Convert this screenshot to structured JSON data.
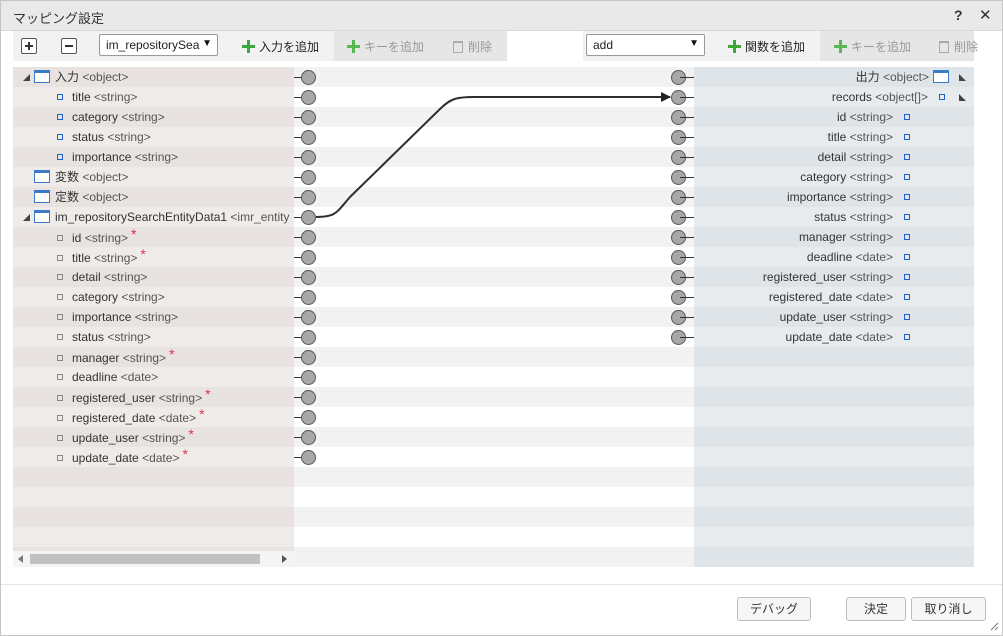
{
  "dialog": {
    "title": "マッピング設定",
    "help_label": "?",
    "close_label": "✕"
  },
  "toolbar_left": {
    "expand_icon": "plus-square-icon",
    "collapse_icon": "minus-square-icon",
    "source_select_value": "im_repositorySea",
    "add_input_label": "入力を追加",
    "add_key_label": "キーを追加",
    "delete_label": "削除"
  },
  "toolbar_right": {
    "function_select_value": "add",
    "add_function_label": "関数を追加",
    "add_key_label": "キーを追加",
    "delete_label": "削除"
  },
  "left_tree": [
    {
      "label": "入力",
      "type": "<object>",
      "kind": "object",
      "expandable": true,
      "indent": 0,
      "required": false
    },
    {
      "label": "title",
      "type": "<string>",
      "kind": "leaf",
      "indent": 1,
      "required": false
    },
    {
      "label": "category",
      "type": "<string>",
      "kind": "leaf",
      "indent": 1,
      "required": false
    },
    {
      "label": "status",
      "type": "<string>",
      "kind": "leaf",
      "indent": 1,
      "required": false
    },
    {
      "label": "importance",
      "type": "<string>",
      "kind": "leaf",
      "indent": 1,
      "required": false
    },
    {
      "label": "変数",
      "type": "<object>",
      "kind": "object",
      "expandable": false,
      "indent": 0,
      "required": false
    },
    {
      "label": "定数",
      "type": "<object>",
      "kind": "object",
      "expandable": false,
      "indent": 0,
      "required": false
    },
    {
      "label": "im_repositorySearchEntityData1",
      "type": "<imr_entity",
      "kind": "object",
      "expandable": true,
      "indent": 0,
      "required": false
    },
    {
      "label": "id",
      "type": "<string>",
      "kind": "leaf-gray",
      "indent": 1,
      "required": true
    },
    {
      "label": "title",
      "type": "<string>",
      "kind": "leaf-gray",
      "indent": 1,
      "required": true
    },
    {
      "label": "detail",
      "type": "<string>",
      "kind": "leaf-gray",
      "indent": 1,
      "required": false
    },
    {
      "label": "category",
      "type": "<string>",
      "kind": "leaf-gray",
      "indent": 1,
      "required": false
    },
    {
      "label": "importance",
      "type": "<string>",
      "kind": "leaf-gray",
      "indent": 1,
      "required": false
    },
    {
      "label": "status",
      "type": "<string>",
      "kind": "leaf-gray",
      "indent": 1,
      "required": false
    },
    {
      "label": "manager",
      "type": "<string>",
      "kind": "leaf-gray",
      "indent": 1,
      "required": true
    },
    {
      "label": "deadline",
      "type": "<date>",
      "kind": "leaf-gray",
      "indent": 1,
      "required": false
    },
    {
      "label": "registered_user",
      "type": "<string>",
      "kind": "leaf-gray",
      "indent": 1,
      "required": true
    },
    {
      "label": "registered_date",
      "type": "<date>",
      "kind": "leaf-gray",
      "indent": 1,
      "required": true
    },
    {
      "label": "update_user",
      "type": "<string>",
      "kind": "leaf-gray",
      "indent": 1,
      "required": true
    },
    {
      "label": "update_date",
      "type": "<date>",
      "kind": "leaf-gray",
      "indent": 1,
      "required": true
    }
  ],
  "right_tree": [
    {
      "label": "出力",
      "type": "<object>",
      "kind": "object",
      "expandable": true
    },
    {
      "label": "records",
      "type": "<object[]>",
      "kind": "leaf",
      "expandable": true
    },
    {
      "label": "id",
      "type": "<string>",
      "kind": "leaf"
    },
    {
      "label": "title",
      "type": "<string>",
      "kind": "leaf"
    },
    {
      "label": "detail",
      "type": "<string>",
      "kind": "leaf"
    },
    {
      "label": "category",
      "type": "<string>",
      "kind": "leaf"
    },
    {
      "label": "importance",
      "type": "<string>",
      "kind": "leaf"
    },
    {
      "label": "status",
      "type": "<string>",
      "kind": "leaf"
    },
    {
      "label": "manager",
      "type": "<string>",
      "kind": "leaf"
    },
    {
      "label": "deadline",
      "type": "<date>",
      "kind": "leaf"
    },
    {
      "label": "registered_user",
      "type": "<string>",
      "kind": "leaf"
    },
    {
      "label": "registered_date",
      "type": "<date>",
      "kind": "leaf"
    },
    {
      "label": "update_user",
      "type": "<string>",
      "kind": "leaf"
    },
    {
      "label": "update_date",
      "type": "<date>",
      "kind": "leaf"
    }
  ],
  "mapping": {
    "from": "im_repositorySearchEntityData1",
    "to": "records"
  },
  "footer": {
    "debug_label": "デバッグ",
    "ok_label": "決定",
    "cancel_label": "取り消し"
  },
  "colors": {
    "accent_green": "#3aa83a",
    "node_blue": "#3a7ac7",
    "required_red": "#e0324b",
    "left_panel": "#ebe4e0",
    "right_panel": "#dfe5ea"
  }
}
